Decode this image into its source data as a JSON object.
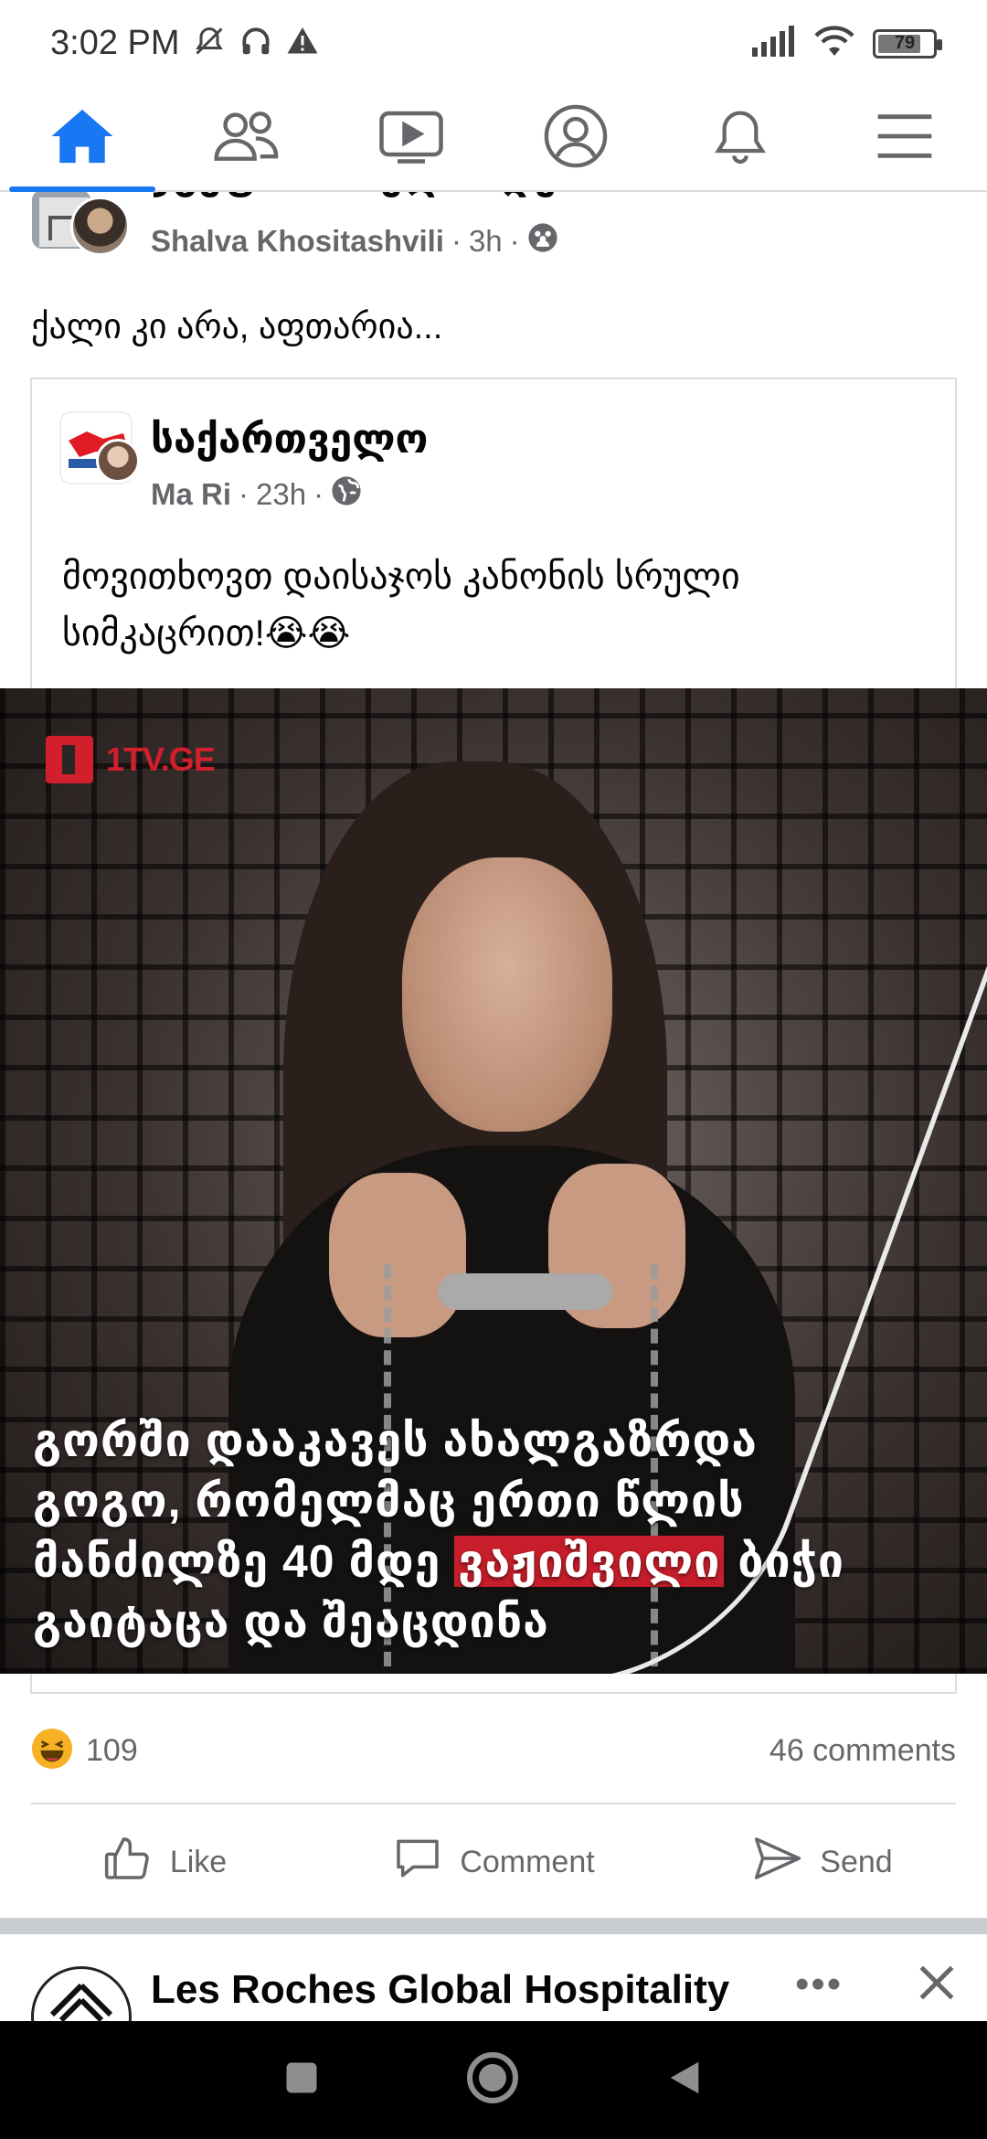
{
  "status_bar": {
    "time": "3:02 PM",
    "battery": "79",
    "battery_level": 0.79,
    "icons_left": [
      "mute-icon",
      "headset-icon",
      "alert-icon"
    ],
    "icons_right": [
      "signal-icon",
      "wifi-icon",
      "battery-icon"
    ]
  },
  "nav": {
    "accent_color": "#1877f2",
    "items": [
      {
        "name": "home",
        "icon": "home-icon",
        "active": true
      },
      {
        "name": "friends",
        "icon": "friends-icon",
        "active": false
      },
      {
        "name": "watch",
        "icon": "video-icon",
        "active": false
      },
      {
        "name": "profile",
        "icon": "profile-icon",
        "active": false
      },
      {
        "name": "notifications",
        "icon": "bell-icon",
        "active": false
      },
      {
        "name": "menu",
        "icon": "menu-icon",
        "active": false
      }
    ]
  },
  "post": {
    "group_title": "ჯგუფის სახელწოდება",
    "author": "Shalva Khositashvili",
    "time": "3h",
    "privacy_icon": "group-icon",
    "text": "ქალი კი არა, აფთარია...",
    "shared": {
      "page_name": "საქართველო",
      "author": "Ma Ri",
      "time": "23h",
      "privacy_icon": "globe-icon",
      "text": "მოვითხოვთ დაისაჯოს კანონის სრული სიმკაცრით!😭😭",
      "image": {
        "logo_text": "1TV.GE",
        "headline_part1": "გორში დააკავეს ახალგაზრდა გოგო, რომელმაც ერთი წლის მანძილზე 40 მდე ",
        "headline_highlight": "ვაჟიშვილი",
        "headline_part2": " ბიჭი გაიტაცა და შეაცდინა",
        "highlight_color": "#c81e2b"
      }
    },
    "reactions": {
      "icon": "laugh-emoji-icon",
      "count": "109"
    },
    "comments": "46 comments",
    "actions": {
      "like": "Like",
      "comment": "Comment",
      "send": "Send"
    }
  },
  "next_post": {
    "title": "Les Roches Global Hospitality",
    "more": "•••"
  }
}
